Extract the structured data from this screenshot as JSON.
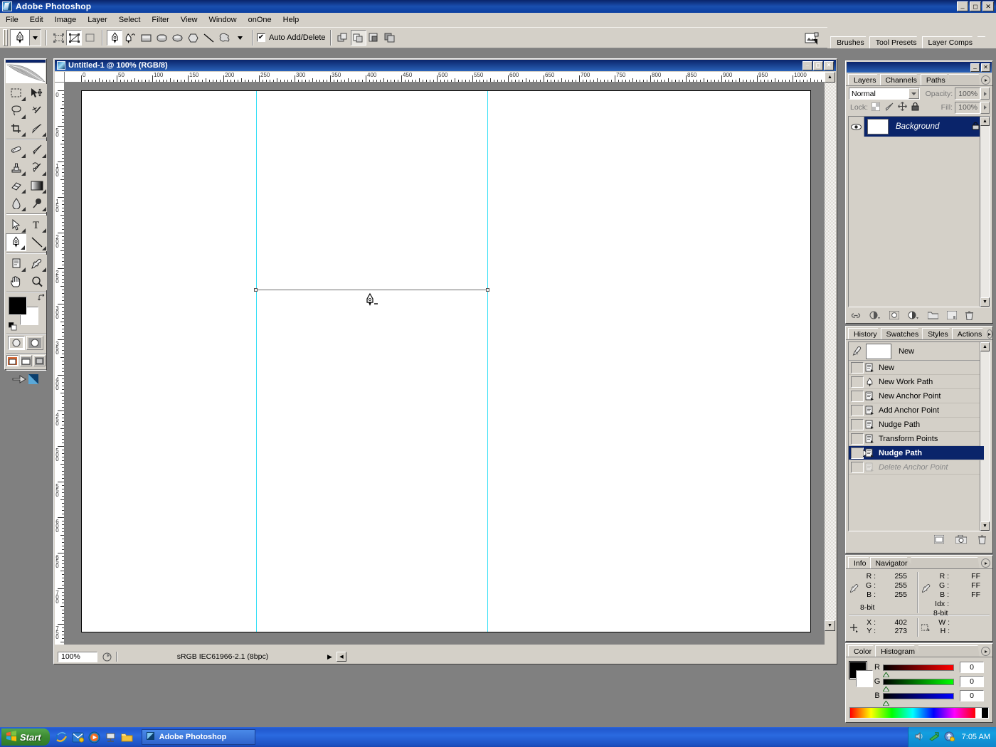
{
  "app": {
    "title": "Adobe Photoshop",
    "icon": "photoshop-logo-icon",
    "window_buttons": {
      "minimize": "_",
      "maximize": "□",
      "close": "✕"
    }
  },
  "menubar": {
    "items": [
      "File",
      "Edit",
      "Image",
      "Layer",
      "Select",
      "Filter",
      "View",
      "Window",
      "onOne",
      "Help"
    ]
  },
  "options_bar": {
    "tool_preset_icon": "pen-tool-icon",
    "preset_dropdown_icon": "chevron-down-icon",
    "mode_buttons": [
      "shape-layers-icon",
      "paths-icon",
      "fill-pixels-icon"
    ],
    "shape_tools": [
      "pen-tool-icon",
      "freeform-pen-icon",
      "rectangle-icon",
      "rounded-rectangle-icon",
      "ellipse-icon",
      "polygon-icon",
      "line-icon",
      "custom-shape-icon"
    ],
    "shape_dropdown_icon": "chevron-down-icon",
    "auto_add_delete": {
      "label": "Auto Add/Delete",
      "checked": true,
      "check_glyph": "✔"
    },
    "path_ops": [
      "add-to-path-icon",
      "subtract-from-path-icon",
      "intersect-path-icon",
      "exclude-path-icon"
    ],
    "palette_well_icon": "palette-well-icon",
    "palette_well_tabs": [
      "Brushes",
      "Tool Presets",
      "Layer Comps"
    ]
  },
  "toolbox": {
    "name": "toolbox-palette",
    "tools": [
      [
        "marquee-tool",
        "move-tool"
      ],
      [
        "lasso-tool",
        "magic-wand-tool"
      ],
      [
        "crop-tool",
        "slice-tool"
      ],
      [
        "healing-brush-tool",
        "brush-tool"
      ],
      [
        "clone-stamp-tool",
        "history-brush-tool"
      ],
      [
        "eraser-tool",
        "gradient-tool"
      ],
      [
        "blur-tool",
        "dodge-tool"
      ],
      [
        "path-selection-tool",
        "type-tool"
      ],
      [
        "pen-tool",
        "line-tool"
      ],
      [
        "notes-tool",
        "eyedropper-tool"
      ],
      [
        "hand-tool",
        "zoom-tool"
      ]
    ],
    "selected_tool": "pen-tool",
    "foreground_color": "#000000",
    "background_color": "#ffffff",
    "swap_colors_icon": "swap-colors-icon",
    "default_colors_icon": "default-colors-icon",
    "quick_mask": [
      "standard-mode-icon",
      "quick-mask-mode-icon"
    ],
    "screen_modes": [
      "standard-screen-mode-icon",
      "full-screen-menubar-icon",
      "full-screen-icon"
    ],
    "jump_to_imageready_icon": "jump-to-imageready-icon"
  },
  "document": {
    "title": "Untitled-1 @ 100% (RGB/8)",
    "icon": "document-icon",
    "window_buttons": {
      "minimize": "_",
      "maximize": "□",
      "close": "✕"
    },
    "zoom": "100%",
    "status_info": "sRGB IEC61966-2.1 (8bpc)",
    "status_arrow": "▶",
    "ruler_h_labels": [
      "0",
      "50",
      "100",
      "150",
      "200",
      "250",
      "300",
      "350",
      "400",
      "450",
      "500",
      "550",
      "600",
      "650",
      "700",
      "750",
      "800",
      "850",
      "900",
      "950",
      "1000"
    ],
    "ruler_v_labels": [
      "0",
      "50",
      "100",
      "150",
      "200",
      "250",
      "300",
      "350",
      "400",
      "450",
      "500",
      "550",
      "600",
      "650",
      "700",
      "750"
    ],
    "guides": {
      "vertical": [
        245,
        570
      ],
      "horizontal": []
    },
    "path": {
      "anchors": 2,
      "cursor_icon": "pen-tool-cursor"
    }
  },
  "layers_palette": {
    "tabs": [
      "Layers",
      "Channels",
      "Paths"
    ],
    "active_tab": "Layers",
    "menu_icon": "palette-menu-icon",
    "blend_mode": "Normal",
    "blend_dropdown_icon": "chevron-down-icon",
    "opacity_label": "Opacity:",
    "opacity_value": "100%",
    "opacity_arrow_icon": "chevron-right-icon",
    "lock_label": "Lock:",
    "lock_icons": [
      "lock-transparency-icon",
      "lock-image-icon",
      "lock-position-icon",
      "lock-all-icon"
    ],
    "fill_label": "Fill:",
    "fill_value": "100%",
    "fill_arrow_icon": "chevron-right-icon",
    "layers": [
      {
        "name": "Background",
        "visible": true,
        "locked": true,
        "eye_icon": "eye-icon",
        "lock_icon": "lock-icon"
      }
    ],
    "bottom_buttons": [
      "link-layers-icon",
      "layer-style-icon",
      "layer-mask-icon",
      "adjustment-layer-icon",
      "new-group-icon",
      "new-layer-icon",
      "delete-layer-icon"
    ]
  },
  "history_palette": {
    "tabs": [
      "History",
      "Swatches",
      "Styles",
      "Actions"
    ],
    "active_tab": "History",
    "menu_icon": "palette-menu-icon",
    "snapshot": {
      "name": "New",
      "icon": "snapshot-icon"
    },
    "states": [
      {
        "label": "New",
        "icon": "document-state-icon",
        "selected": false,
        "dimmed": false
      },
      {
        "label": "New Work Path",
        "icon": "pen-state-icon",
        "selected": false,
        "dimmed": false
      },
      {
        "label": "New Anchor Point",
        "icon": "document-state-icon",
        "selected": false,
        "dimmed": false
      },
      {
        "label": "Add Anchor Point",
        "icon": "document-state-icon",
        "selected": false,
        "dimmed": false
      },
      {
        "label": "Nudge Path",
        "icon": "document-state-icon",
        "selected": false,
        "dimmed": false
      },
      {
        "label": "Transform Points",
        "icon": "document-state-icon",
        "selected": false,
        "dimmed": false
      },
      {
        "label": "Nudge Path",
        "icon": "document-state-icon",
        "selected": true,
        "dimmed": false
      },
      {
        "label": "Delete Anchor Point",
        "icon": "document-state-icon",
        "selected": false,
        "dimmed": true
      }
    ],
    "bottom_buttons": [
      "new-document-from-state-icon",
      "new-snapshot-icon",
      "delete-state-icon"
    ]
  },
  "info_palette": {
    "tabs": [
      "Info",
      "Navigator"
    ],
    "active_tab": "Info",
    "menu_icon": "palette-menu-icon",
    "left_readout": {
      "icon": "eyedropper-icon",
      "rows": [
        {
          "label": "R :",
          "value": "255"
        },
        {
          "label": "G :",
          "value": "255"
        },
        {
          "label": "B :",
          "value": "255"
        }
      ],
      "depth": "8-bit"
    },
    "right_readout": {
      "icon": "eyedropper-icon",
      "rows": [
        {
          "label": "R :",
          "value": "FF"
        },
        {
          "label": "G :",
          "value": "FF"
        },
        {
          "label": "B :",
          "value": "FF"
        },
        {
          "label": "Idx :",
          "value": ""
        }
      ],
      "depth": "8-bit"
    },
    "position": {
      "icon": "crosshair-icon",
      "rows": [
        {
          "label": "X :",
          "value": "402"
        },
        {
          "label": "Y :",
          "value": "273"
        }
      ]
    },
    "dimensions": {
      "icon": "selection-size-icon",
      "rows": [
        {
          "label": "W :",
          "value": ""
        },
        {
          "label": "H :",
          "value": ""
        }
      ]
    }
  },
  "color_palette": {
    "tabs": [
      "Color",
      "Histogram"
    ],
    "active_tab": "Color",
    "menu_icon": "palette-menu-icon",
    "foreground_color": "#000000",
    "background_color": "#ffffff",
    "channels": [
      {
        "label": "R",
        "value": "0",
        "from": "#000000",
        "to": "#ff0000"
      },
      {
        "label": "G",
        "value": "0",
        "from": "#000000",
        "to": "#00ff00"
      },
      {
        "label": "B",
        "value": "0",
        "from": "#000000",
        "to": "#0000ff"
      }
    ],
    "spectrum_icon": "color-ramp-icon"
  },
  "taskbar": {
    "start_label": "Start",
    "start_icon": "windows-flag-icon",
    "quick_launch": [
      "internet-explorer-icon",
      "outlook-express-icon",
      "media-player-icon",
      "show-desktop-icon",
      "folder-icon"
    ],
    "tasks": [
      {
        "label": "Adobe Photoshop",
        "icon": "photoshop-logo-icon",
        "active": true
      }
    ],
    "tray_icons": [
      "volume-icon",
      "network-icon",
      "update-icon"
    ],
    "clock": "7:05 AM"
  }
}
